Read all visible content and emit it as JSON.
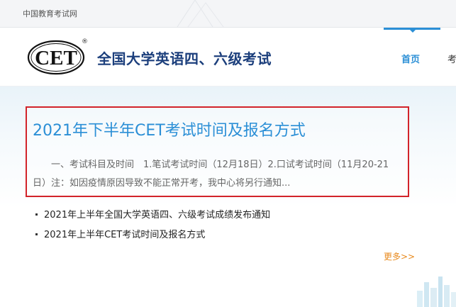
{
  "topbar": {
    "site_name": "中国教育考试网"
  },
  "header": {
    "logo_text": "CET",
    "registered_mark": "®",
    "title": "全国大学英语四、六级考试",
    "nav": {
      "home": "首页",
      "next": "考"
    }
  },
  "feature": {
    "title": "2021年下半年CET考试时间及报名方式",
    "summary": "一、考试科目及时间　1.笔试考试时间（12月18日）2.口试考试时间（11月20-21日）注：如因疫情原因导致不能正常开考，我中心将另行通知..."
  },
  "news": [
    {
      "title": "2021年上半年全国大学英语四、六级考试成绩发布通知"
    },
    {
      "title": "2021年上半年CET考试时间及报名方式"
    }
  ],
  "more_label": "更多>>",
  "colors": {
    "accent": "#2b8fd6",
    "title_navy": "#1c3f7c",
    "highlight_border": "#d2232a",
    "more_orange": "#e8891c"
  }
}
